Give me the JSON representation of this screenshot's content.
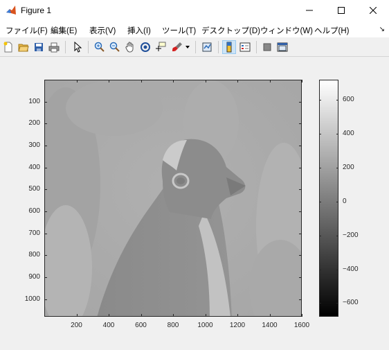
{
  "window": {
    "title": "Figure 1"
  },
  "menu": {
    "items": [
      {
        "label": "ファイル(F)"
      },
      {
        "label": "編集(E)"
      },
      {
        "label": "表示(V)"
      },
      {
        "label": "挿入(I)"
      },
      {
        "label": "ツール(T)"
      },
      {
        "label": "デスクトップ(D)"
      },
      {
        "label": "ウィンドウ(W)"
      },
      {
        "label": "ヘルプ(H)"
      }
    ]
  },
  "toolbar": {
    "buttons": [
      {
        "icon": "new-figure-icon"
      },
      {
        "icon": "open-file-icon"
      },
      {
        "icon": "save-icon"
      },
      {
        "icon": "print-icon"
      },
      {
        "icon": "pointer-icon"
      },
      {
        "icon": "zoom-in-icon"
      },
      {
        "icon": "zoom-out-icon"
      },
      {
        "icon": "pan-hand-icon"
      },
      {
        "icon": "rotate-3d-icon"
      },
      {
        "icon": "data-cursor-icon"
      },
      {
        "icon": "brush-icon"
      },
      {
        "icon": "link-plot-icon"
      },
      {
        "icon": "colorbar-icon",
        "active": true
      },
      {
        "icon": "legend-icon"
      },
      {
        "icon": "hide-plot-tools-icon"
      },
      {
        "icon": "show-plot-tools-icon"
      }
    ]
  },
  "chart_data": {
    "type": "heatmap",
    "title": "",
    "xlabel": "",
    "ylabel": "",
    "xlim": [
      0,
      1600
    ],
    "ylim": [
      1080,
      0
    ],
    "x_ticks": [
      200,
      400,
      600,
      800,
      1000,
      1200,
      1400,
      1600
    ],
    "y_ticks": [
      100,
      200,
      300,
      400,
      500,
      600,
      700,
      800,
      900,
      1000
    ],
    "image_subject": "grayscale penguin image",
    "colormap": "gray",
    "colorbar": {
      "clim": [
        -680,
        720
      ],
      "ticks": [
        600,
        400,
        200,
        0,
        -200,
        -400,
        -600
      ],
      "tick_labels": [
        "600",
        "400",
        "200",
        "0",
        "−200",
        "−400",
        "−600"
      ]
    }
  }
}
